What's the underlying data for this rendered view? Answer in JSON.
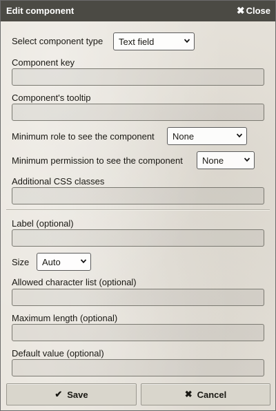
{
  "window": {
    "title": "Edit component",
    "close_label": "Close"
  },
  "form": {
    "component_type": {
      "label": "Select component type",
      "value": "Text field"
    },
    "component_key": {
      "label": "Component key",
      "value": ""
    },
    "tooltip": {
      "label": "Component's tooltip",
      "value": ""
    },
    "min_role": {
      "label": "Minimum role to see the component",
      "value": "None"
    },
    "min_permission": {
      "label": "Minimum permission to see the component",
      "value": "None"
    },
    "css_classes": {
      "label": "Additional CSS classes",
      "value": ""
    },
    "label_field": {
      "label": "Label (optional)",
      "value": ""
    },
    "size": {
      "label": "Size",
      "value": "Auto"
    },
    "allowed_chars": {
      "label": "Allowed character list (optional)",
      "value": ""
    },
    "max_length": {
      "label": "Maximum length (optional)",
      "value": ""
    },
    "default_value": {
      "label": "Default value (optional)",
      "value": ""
    }
  },
  "buttons": {
    "save_label": "Save",
    "cancel_label": "Cancel"
  },
  "icons": {
    "close": "close-icon",
    "save": "check-icon",
    "cancel": "x-icon",
    "dropdown": "chevron-down-icon"
  }
}
